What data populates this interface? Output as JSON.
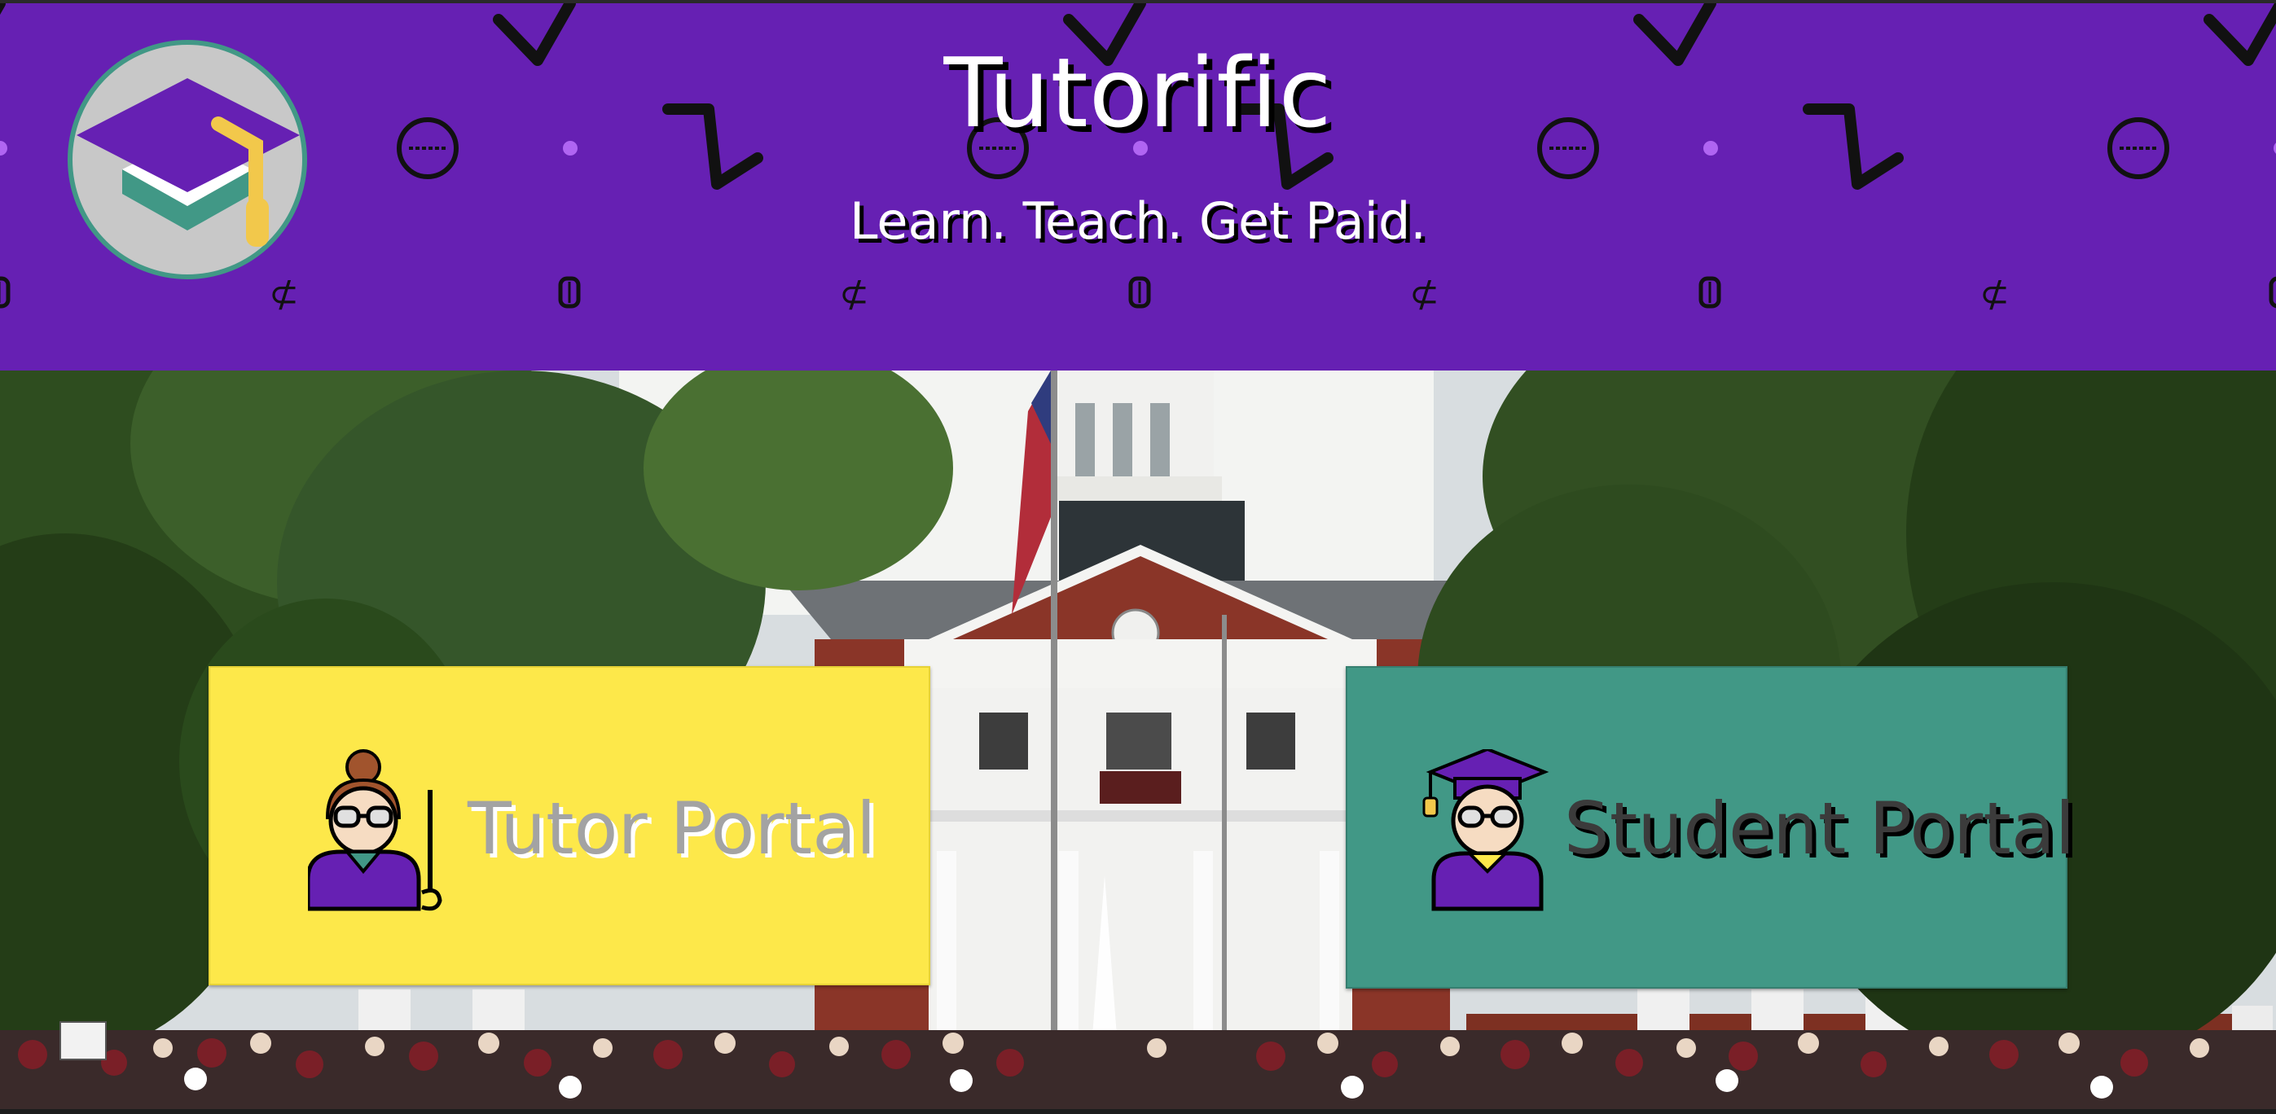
{
  "header": {
    "title": "Tutorific",
    "tagline": "Learn. Teach. Get Paid.",
    "background_color": "#6620b3",
    "logo_icon": "graduation-cap-icon"
  },
  "hero": {
    "image_subject": "campus-graduation-photo"
  },
  "portals": {
    "tutor": {
      "label": "Tutor Portal",
      "icon": "tutor-teacher-icon",
      "background_color": "#fde84a"
    },
    "student": {
      "label": "Student Portal",
      "icon": "student-graduate-icon",
      "background_color": "#419886"
    }
  }
}
